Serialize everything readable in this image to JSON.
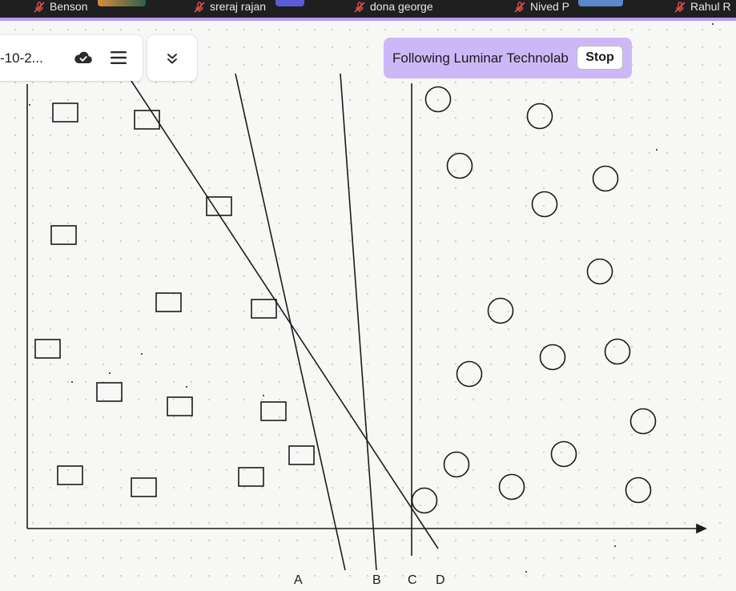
{
  "participants": [
    {
      "name": "Benson",
      "tile_color": "#e08a3a"
    },
    {
      "name": "sreraj rajan",
      "tile_color": "#5b5bd6"
    },
    {
      "name": "dona george",
      "tile_color": ""
    },
    {
      "name": "Nived P",
      "tile_color": "#5a87c9"
    },
    {
      "name": "Rahul R"
    }
  ],
  "toolbar": {
    "file_name": "-10-2...",
    "cloud_icon": "cloud-check-icon",
    "menu_icon": "hamburger-menu-icon",
    "collapse_icon": "chevrons-down-icon"
  },
  "follow_banner": {
    "text": "Following Luminar Technolab",
    "stop_label": "Stop",
    "background": "#cdb8f7"
  },
  "canvas": {
    "line_labels": [
      "A",
      "B",
      "C",
      "D"
    ],
    "stroke_color": "#1b1b1b",
    "accent_color": "#b99cf0"
  }
}
